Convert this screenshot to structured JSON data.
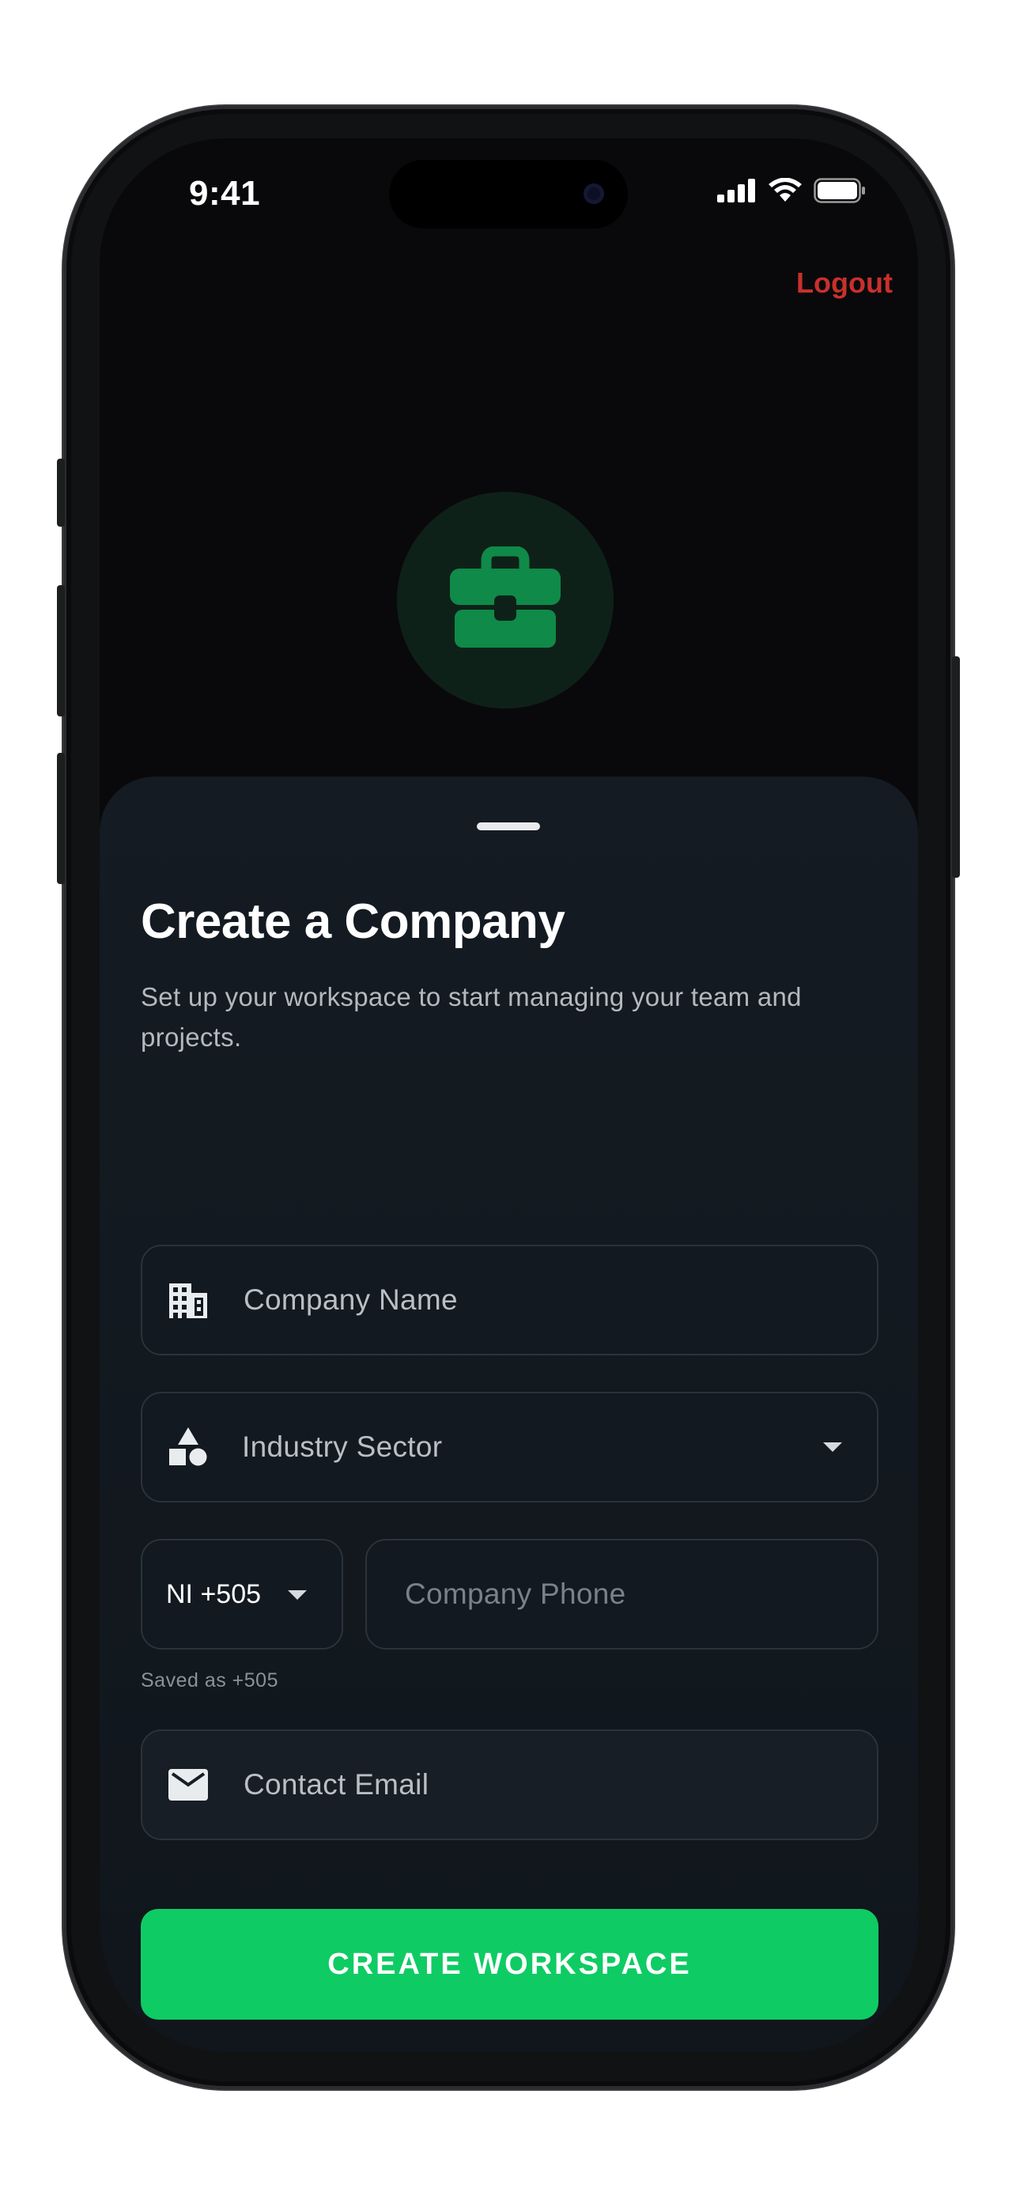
{
  "status_bar": {
    "time": "9:41"
  },
  "header": {
    "logout_label": "Logout"
  },
  "hero": {
    "icon": "briefcase-icon"
  },
  "sheet": {
    "title": "Create a Company",
    "subtitle": "Set up your workspace to start managing your team and projects.",
    "fields": {
      "company_name": {
        "placeholder": "Company Name",
        "icon": "building-icon"
      },
      "industry_sector": {
        "placeholder": "Industry Sector",
        "icon": "shapes-icon"
      },
      "country_code": {
        "value": "NI +505"
      },
      "company_phone": {
        "placeholder": "Company Phone"
      },
      "contact_email": {
        "placeholder": "Contact Email",
        "icon": "mail-icon"
      }
    },
    "phone_helper": "Saved as +505",
    "submit_label": "CREATE WORKSPACE"
  },
  "colors": {
    "accent": "#0fcb64",
    "logout": "#c8302c",
    "sheet_background": "#141b22",
    "screen_background": "#09090b"
  }
}
